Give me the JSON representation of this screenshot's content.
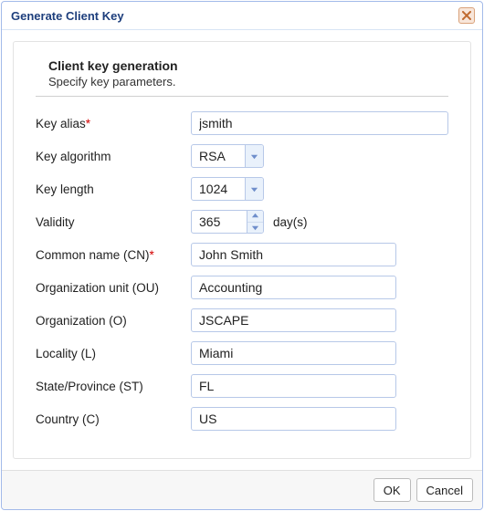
{
  "dialog": {
    "title": "Generate Client Key"
  },
  "section": {
    "title": "Client key generation",
    "subtitle": "Specify key parameters."
  },
  "labels": {
    "key_alias": "Key alias",
    "key_algorithm": "Key algorithm",
    "key_length": "Key length",
    "validity": "Validity",
    "validity_suffix": "day(s)",
    "common_name": "Common name (CN)",
    "org_unit": "Organization unit (OU)",
    "organization": "Organization (O)",
    "locality": "Locality (L)",
    "state": "State/Province (ST)",
    "country": "Country (C)",
    "required_mark": "*"
  },
  "values": {
    "key_alias": "jsmith",
    "key_algorithm": "RSA",
    "key_length": "1024",
    "validity": "365",
    "common_name": "John Smith",
    "org_unit": "Accounting",
    "organization": "JSCAPE",
    "locality": "Miami",
    "state": "FL",
    "country": "US"
  },
  "buttons": {
    "ok": "OK",
    "cancel": "Cancel"
  }
}
